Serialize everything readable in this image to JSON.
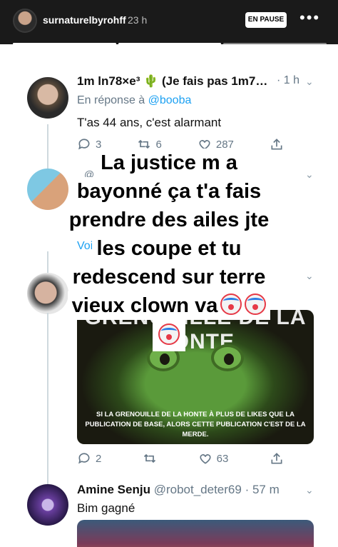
{
  "story": {
    "username": "surnaturelbyrohff",
    "time": "23 h",
    "paused_label": "EN PAUSE",
    "more_glyph": "•••",
    "progress": {
      "segments": 3,
      "current": 2
    }
  },
  "tweets": [
    {
      "name": "1m ln78×e³ 🌵 (Je fais pas 1m7…",
      "time": "· 1 h",
      "reply_prefix": "En réponse à ",
      "reply_handle": "@booba",
      "text": "T'as 44 ans, c'est alarmant",
      "replies": "3",
      "retweets": "6",
      "likes": "287"
    },
    {
      "name": "@",
      "partial_text": "Voi"
    },
    {
      "media_top": "GRENOUILLE DE LA HONTE",
      "media_bottom": "SI LA GRENOUILLE DE LA HONTE À PLUS DE LIKES QUE LA PUBLICATION DE BASE, ALORS CETTE PUBLICATION C'EST DE LA MERDE.",
      "replies": "2",
      "likes": "63"
    },
    {
      "name": "Amine Senju",
      "handle": "@robot_deter69",
      "time": "· 57 m",
      "text": "Bim gagné"
    }
  ],
  "overlay": {
    "lines": [
      "La justice m a",
      "bayonné ça t'a fais",
      "prendre des ailes jte",
      "les coupe et tu",
      "redescend sur terre",
      "vieux clown va"
    ],
    "emoji": "clown-face-icon"
  },
  "colors": {
    "link": "#1da1f2",
    "muted": "#657786",
    "bg": "#ffffff"
  }
}
